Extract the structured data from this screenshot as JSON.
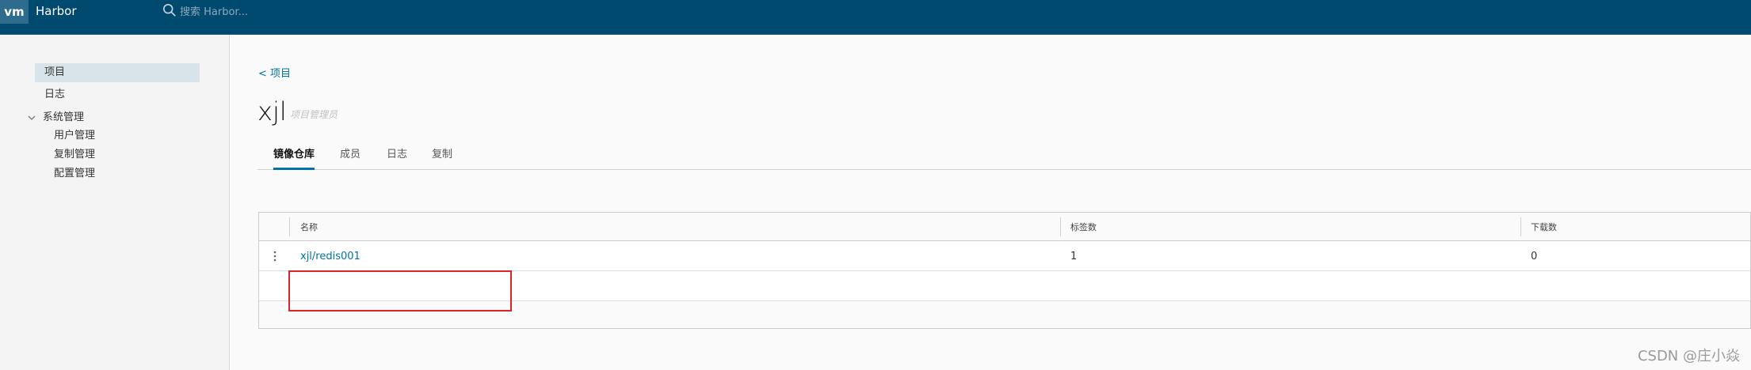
{
  "header": {
    "logo": "vm",
    "brand": "Harbor",
    "search_placeholder": "搜索 Harbor..."
  },
  "sidebar": {
    "items": [
      {
        "label": "项目"
      },
      {
        "label": "日志"
      }
    ],
    "group": {
      "label": "系统管理",
      "children": [
        "用户管理",
        "复制管理",
        "配置管理"
      ]
    }
  },
  "main": {
    "breadcrumb": "< 项目",
    "project_name": "xjl",
    "role": "项目管理员",
    "tabs": [
      "镜像仓库",
      "成员",
      "日志",
      "复制"
    ],
    "active_tab": "镜像仓库",
    "table": {
      "columns": [
        "名称",
        "标签数",
        "下载数"
      ],
      "rows": [
        {
          "name": "xjl/redis001",
          "tags": "1",
          "pulls": "0"
        }
      ]
    }
  },
  "watermark": "CSDN @庄小焱",
  "colors": {
    "header_bg": "#004a70",
    "accent": "#0072a3",
    "highlight": "#d6262a"
  }
}
